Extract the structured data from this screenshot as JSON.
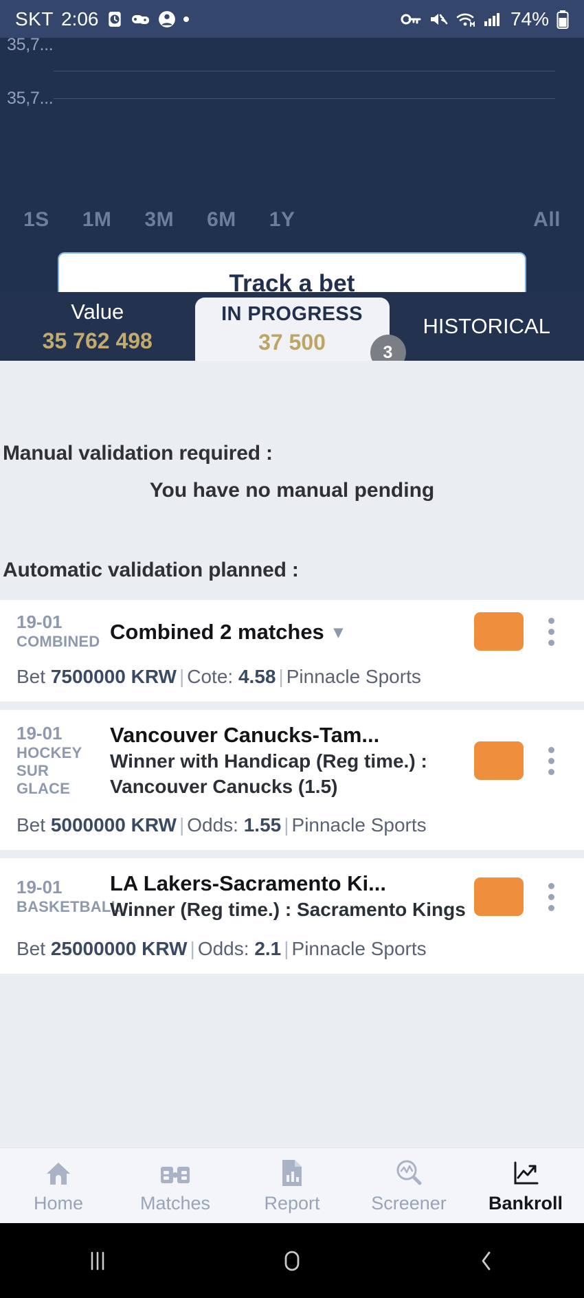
{
  "status_bar": {
    "carrier": "SKT",
    "clock": "2:06",
    "battery_percent": "74%",
    "icons_left": [
      "alarm-icon",
      "game-controller-icon",
      "account-icon",
      "dot-icon"
    ],
    "icons_right": [
      "vpn-key-icon",
      "mute-icon",
      "wifi-icon",
      "signal-icon",
      "battery-icon"
    ]
  },
  "chart_data": {
    "type": "line",
    "title": "",
    "xlabel": "",
    "ylabel": "",
    "grid": true,
    "ytick_labels": [
      "35,7...",
      "35,7..."
    ],
    "x": [],
    "values": [],
    "legend": []
  },
  "chart_panel": {
    "ranges": [
      {
        "label": "1S",
        "active": false
      },
      {
        "label": "1M",
        "active": false
      },
      {
        "label": "3M",
        "active": false
      },
      {
        "label": "6M",
        "active": false
      },
      {
        "label": "1Y",
        "active": false
      }
    ],
    "range_all": "All",
    "track_button": "Track a bet"
  },
  "tabs": [
    {
      "label": "Value",
      "value": "35 762 498",
      "active": false
    },
    {
      "label": "IN PROGRESS",
      "value": "37 500",
      "active": true,
      "badge": "3"
    },
    {
      "label": "HISTORICAL",
      "value": "",
      "active": false
    }
  ],
  "main": {
    "manual_heading": "Manual validation required :",
    "manual_empty": "You have no manual pending",
    "auto_heading": "Automatic validation planned :"
  },
  "bets": [
    {
      "date": "19-01",
      "sport": "COMBINED",
      "title": "Combined 2 matches",
      "has_chevron": true,
      "subtitle": "",
      "bet_label": "Bet",
      "stake": "7500000 KRW",
      "odds_label": "Cote:",
      "odds": "4.58",
      "bookmaker": "Pinnacle Sports",
      "status_color": "#ef8e3c"
    },
    {
      "date": "19-01",
      "sport": "HOCKEY SUR GLACE",
      "title": "Vancouver Canucks-Tam...",
      "has_chevron": false,
      "subtitle": "Winner with Handicap (Reg time.) : Vancouver Canucks (1.5)",
      "bet_label": "Bet",
      "stake": "5000000 KRW",
      "odds_label": "Odds:",
      "odds": "1.55",
      "bookmaker": "Pinnacle Sports",
      "status_color": "#ef8e3c"
    },
    {
      "date": "19-01",
      "sport": "BASKETBALL",
      "title": "LA Lakers-Sacramento Ki...",
      "has_chevron": false,
      "subtitle": "Winner (Reg time.) : Sacramento Kings",
      "bet_label": "Bet",
      "stake": "25000000 KRW",
      "odds_label": "Odds:",
      "odds": "2.1",
      "bookmaker": "Pinnacle Sports",
      "status_color": "#ef8e3c"
    }
  ],
  "bottom_nav": [
    {
      "label": "Home",
      "icon": "home-icon",
      "active": false
    },
    {
      "label": "Matches",
      "icon": "matches-icon",
      "active": false
    },
    {
      "label": "Report",
      "icon": "report-icon",
      "active": false
    },
    {
      "label": "Screener",
      "icon": "screener-icon",
      "active": false
    },
    {
      "label": "Bankroll",
      "icon": "bankroll-icon",
      "active": true
    }
  ],
  "android_nav": [
    "recents-icon",
    "home-circle-icon",
    "back-icon"
  ],
  "colors": {
    "accent_orange": "#ef8e3c",
    "gold": "#c3ab6d",
    "navy": "#20304f",
    "panel_bg": "#eaedf2"
  }
}
